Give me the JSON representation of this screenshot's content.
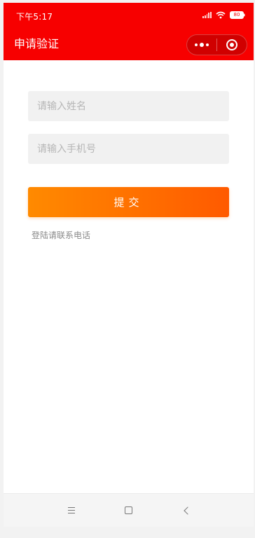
{
  "status_bar": {
    "time": "下午5:17",
    "battery": "80",
    "icons": [
      "signal-icon",
      "wifi-icon",
      "battery-icon"
    ]
  },
  "nav": {
    "title": "申请验证",
    "capsule_icons": [
      "more-icon",
      "target-icon"
    ]
  },
  "form": {
    "name_placeholder": "请输入姓名",
    "name_value": "",
    "phone_placeholder": "请输入手机号",
    "phone_value": "",
    "submit_label": "提交"
  },
  "hint": {
    "text": "登陆请联系电话"
  },
  "android_nav": {
    "icons": [
      "menu-icon",
      "home-icon",
      "back-icon"
    ]
  },
  "colors": {
    "header": "#f70000",
    "button_start": "#ff8a00",
    "button_end": "#ff5a00",
    "field_bg": "#f1f1f1"
  }
}
